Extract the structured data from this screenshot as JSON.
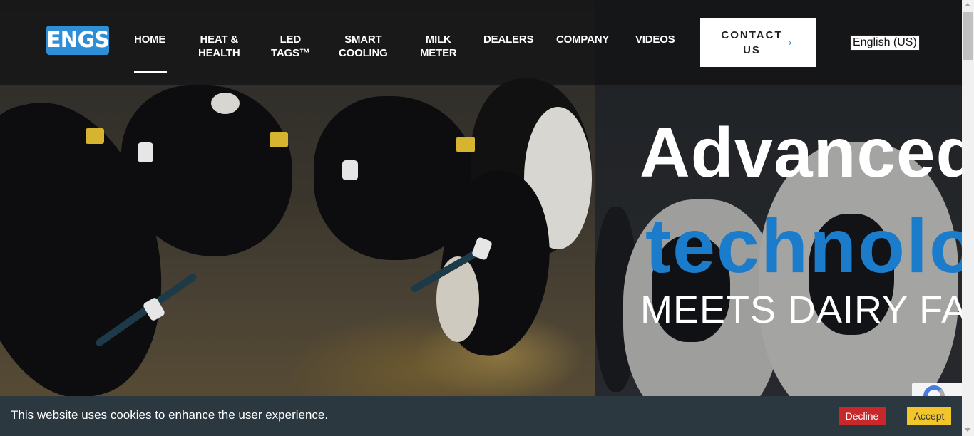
{
  "header": {
    "logo_text": "ENGS",
    "nav": [
      {
        "line1": "HOME",
        "line2": ""
      },
      {
        "line1": "HEAT &",
        "line2": "HEALTH"
      },
      {
        "line1": "LED",
        "line2": "TAGS™"
      },
      {
        "line1": "SMART",
        "line2": "COOLING"
      },
      {
        "line1": "MILK",
        "line2": "METER"
      },
      {
        "line1": "DEALERS",
        "line2": ""
      },
      {
        "line1": "COMPANY",
        "line2": ""
      },
      {
        "line1": "VIDEOS",
        "line2": ""
      }
    ],
    "active_nav": "HOME",
    "contact_line1": "CONTACT",
    "contact_line2": "US",
    "contact_arrow": "→",
    "language": "English (US)"
  },
  "hero": {
    "line1": "Advanced",
    "line2": "technology",
    "line3": "MEETS DAIRY FARMING"
  },
  "cookie": {
    "message": "This website uses cookies to enhance the user experience.",
    "decline_label": "Decline",
    "accept_label": "Accept"
  },
  "colors": {
    "brand_blue": "#2f8fd6",
    "headline_blue": "#1c7ccc",
    "decline_red": "#c8282a",
    "accept_yellow": "#f2c62a",
    "cookie_bar": "#2b3840"
  }
}
